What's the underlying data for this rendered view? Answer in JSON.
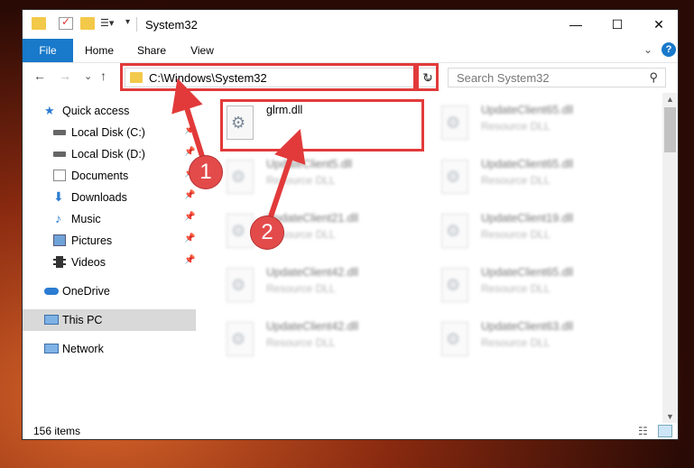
{
  "window": {
    "title": "System32",
    "controls": {
      "minimize": "—",
      "maximize": "☐",
      "close": "✕"
    }
  },
  "ribbon": {
    "tabs": [
      "File",
      "Home",
      "Share",
      "View"
    ],
    "collapse_glyph": "⌄",
    "help_glyph": "?"
  },
  "navbar": {
    "back": "←",
    "forward": "→",
    "recent": "⌄",
    "up": "↑",
    "address": "C:\\Windows\\System32",
    "address_drop": "⌄",
    "refresh": "↻",
    "search_placeholder": "Search System32",
    "search_glyph": "⚲"
  },
  "sidebar": {
    "items": [
      {
        "label": "Quick access",
        "icon": "star-icon",
        "pinned": false
      },
      {
        "label": "Local Disk (C:)",
        "icon": "drive-icon",
        "pinned": true
      },
      {
        "label": "Local Disk (D:)",
        "icon": "drive-icon",
        "pinned": true
      },
      {
        "label": "Documents",
        "icon": "documents-icon",
        "pinned": true
      },
      {
        "label": "Downloads",
        "icon": "download-icon",
        "pinned": true
      },
      {
        "label": "Music",
        "icon": "music-icon",
        "pinned": true
      },
      {
        "label": "Pictures",
        "icon": "pictures-icon",
        "pinned": true
      },
      {
        "label": "Videos",
        "icon": "videos-icon",
        "pinned": true
      },
      {
        "label": "OneDrive",
        "icon": "cloud-icon",
        "pinned": false
      },
      {
        "label": "This PC",
        "icon": "computer-icon",
        "pinned": false,
        "selected": true
      },
      {
        "label": "Network",
        "icon": "network-icon",
        "pinned": false
      }
    ],
    "pin_glyph": "📌"
  },
  "files": [
    {
      "name": "glrm.dll",
      "type": "",
      "highlighted": true
    },
    {
      "name": "UpdateClient65.dll",
      "type": "Resource DLL"
    },
    {
      "name": "UpdateClient5.dll",
      "type": "Resource DLL"
    },
    {
      "name": "UpdateClient65.dll",
      "type": "Resource DLL"
    },
    {
      "name": "UpdateClient21.dll",
      "type": "Resource DLL"
    },
    {
      "name": "UpdateClient19.dll",
      "type": "Resource DLL"
    },
    {
      "name": "UpdateClient42.dll",
      "type": "Resource DLL"
    },
    {
      "name": "UpdateClient65.dll",
      "type": "Resource DLL"
    },
    {
      "name": "UpdateClient42.dll",
      "type": "Resource DLL"
    },
    {
      "name": "UpdateClient63.dll",
      "type": "Resource DLL"
    }
  ],
  "status": {
    "count": "156 items"
  },
  "annotations": {
    "step1": "1",
    "step2": "2",
    "color": "#e23a3a"
  }
}
